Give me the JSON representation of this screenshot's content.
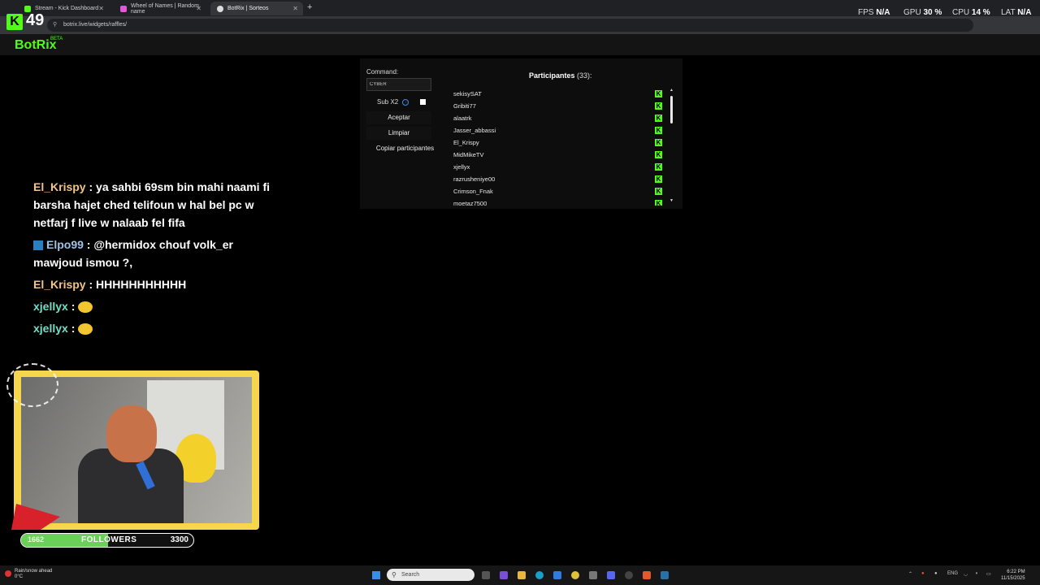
{
  "browser": {
    "tabs": [
      {
        "title": "Stream - Kick Dashboard",
        "color": "#53fc18",
        "active": false
      },
      {
        "title": "Wheel of Names | Random name",
        "color": "#e05ad8",
        "active": false
      },
      {
        "title": "BotRix | Sorteos",
        "color": "#dddddd",
        "active": true
      }
    ],
    "new_tab": "+",
    "url": "botrix.live/widgets/raffles/"
  },
  "overlay_hud": {
    "fps_label": "FPS",
    "fps_value": "N/A",
    "gpu_label": "GPU",
    "gpu_value": "30 %",
    "cpu_label": "CPU",
    "cpu_value": "14 %",
    "lat_label": "LAT",
    "lat_value": "N/A"
  },
  "kick": {
    "logo": "K",
    "viewers": "49"
  },
  "botrix": {
    "logo": "BotRix",
    "beta": "BETA"
  },
  "raffle": {
    "command_label": "Command:",
    "command_value": "CYBER",
    "sub_label": "Sub X2",
    "accept_button": "Aceptar",
    "clear_button": "Limpiar",
    "copy_button": "Copiar participantes",
    "participants_title": "Participantes",
    "participants_count": "(33):",
    "participants": [
      "sekisySAT",
      "Gribiti77",
      "alaatrk",
      "Jasser_abbassi",
      "El_Krispy",
      "MidMikeTV",
      "xjellyx",
      "razrusheniye00",
      "Crimson_Fnak",
      "moetaz7500"
    ],
    "platform_icon": "K"
  },
  "chat": {
    "messages": [
      {
        "user": "El_Krispy",
        "text": ": ya sahbi 69sm bin mahi naami fi barsha hajet ched telifoun w hal bel pc w netfarj f live w nalaab fel fifa"
      },
      {
        "user": "Elpo99",
        "text": ": @hermidox chouf volk_er mawjoud ismou ?,"
      },
      {
        "user": "El_Krispy",
        "text": ": HHHHHHHHHHH"
      },
      {
        "user": "xjellyx",
        "text": ":"
      },
      {
        "user": "xjellyx",
        "text": ":"
      }
    ]
  },
  "followers_goal": {
    "current": "1662",
    "label": "FOLLOWERS",
    "target": "3300",
    "progress": 0.5036
  },
  "taskbar": {
    "weather_line1": "Rain/snow ahead",
    "weather_line2": "0°C",
    "search_placeholder": "Search",
    "lang": "ENG",
    "time": "6:22 PM",
    "date": "11/15/2025"
  }
}
